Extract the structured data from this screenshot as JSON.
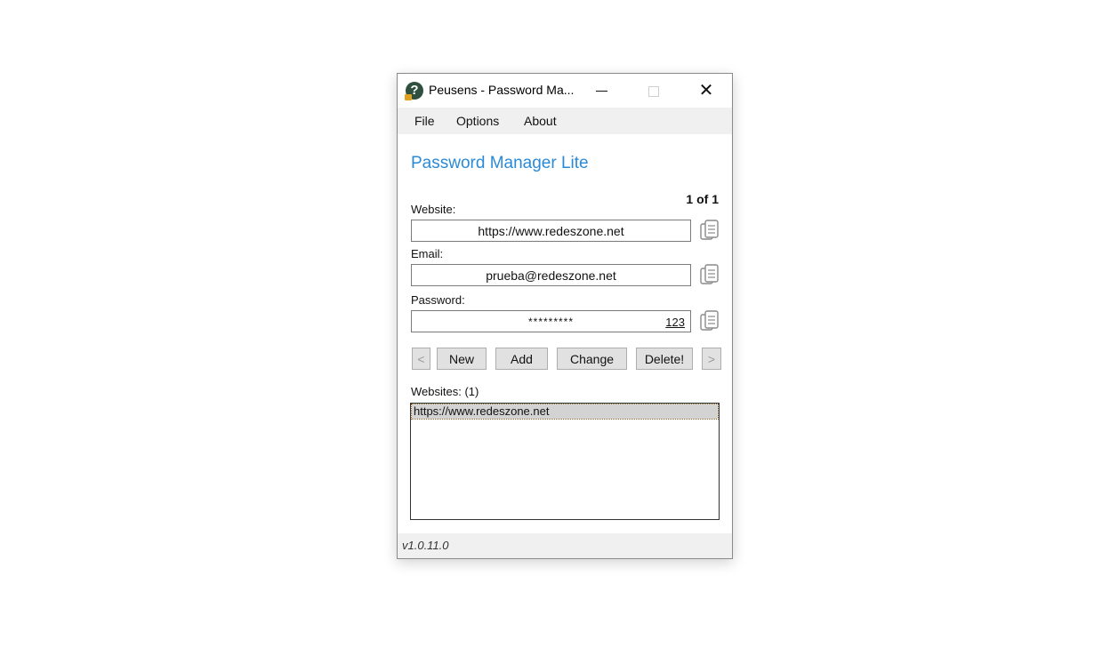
{
  "window": {
    "title": "Peusens - Password Ma...",
    "icon": "question-mark-app-icon",
    "controls": {
      "minimize": "minimize",
      "maximize": "maximize",
      "close": "✕"
    }
  },
  "menu": {
    "items": [
      {
        "label": "File"
      },
      {
        "label": "Options"
      },
      {
        "label": "About"
      }
    ]
  },
  "header": {
    "title": "Password Manager Lite",
    "title_color": "#2b8ad6",
    "counter": "1 of 1"
  },
  "form": {
    "website": {
      "label": "Website:",
      "value": "https://www.redeszone.net"
    },
    "email": {
      "label": "Email:",
      "value": "prueba@redeszone.net"
    },
    "password": {
      "label": "Password:",
      "value": "*********",
      "show_toggle": "123"
    },
    "copy_icon": "copy-clipboard-icon"
  },
  "buttons": {
    "prev": "<",
    "new": "New",
    "add": "Add",
    "change": "Change",
    "delete": "Delete!",
    "next": ">"
  },
  "websites": {
    "label": "Websites: (1)",
    "items": [
      "https://www.redeszone.net"
    ],
    "selected_index": 0
  },
  "status": {
    "version": "v1.0.11.0"
  }
}
